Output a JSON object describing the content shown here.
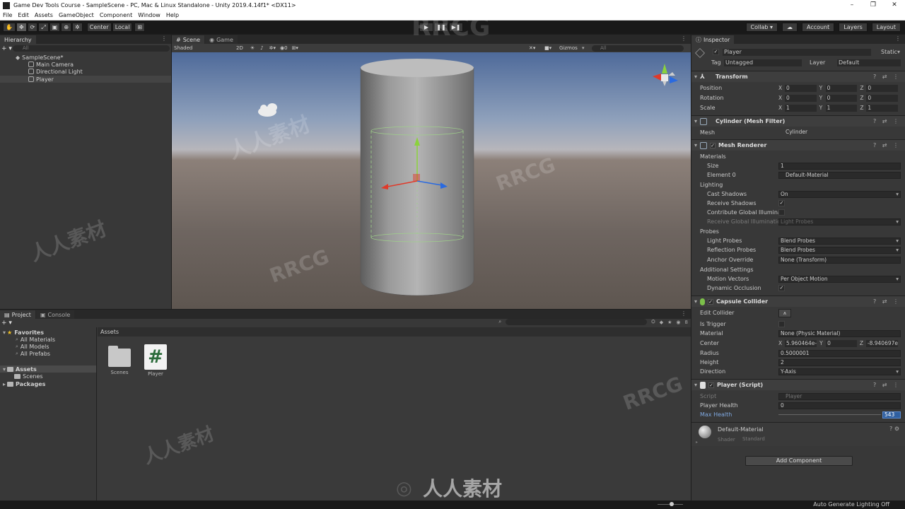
{
  "window": {
    "title": "Game Dev Tools Course - SampleScene - PC, Mac & Linux Standalone - Unity 2019.4.14f1* <DX11>",
    "controls": [
      "–",
      "❐",
      "✕"
    ]
  },
  "menu": [
    "File",
    "Edit",
    "Assets",
    "GameObject",
    "Component",
    "Window",
    "Help"
  ],
  "toolbar": {
    "tools": [
      "✋",
      "✥",
      "⟳",
      "⤢",
      "▣",
      "⊕",
      "✲"
    ],
    "center_label": "Center",
    "local_label": "Local",
    "snap_icon": "⊞",
    "play": "▶",
    "pause": "❚❚",
    "step": "▶❚",
    "collab_label": "Collab ▾",
    "cloud_icon": "☁",
    "account_label": "Account",
    "layers_label": "Layers",
    "layout_label": "Layout"
  },
  "hierarchy": {
    "tab": "Hierarchy",
    "plus": "+ ▾",
    "search_placeholder": "All",
    "menu": "⋮",
    "items": [
      "SampleScene*",
      "Main Camera",
      "Directional Light",
      "Player"
    ]
  },
  "scene": {
    "tabs": [
      "Scene",
      "Game"
    ],
    "menu": "⋮",
    "shading": "Shaded",
    "mode_2d": "2D",
    "effects_count": "0",
    "gizmos_label": "Gizmos",
    "search_placeholder": "All"
  },
  "project": {
    "tabs": [
      "Project",
      "Console"
    ],
    "plus": "+ ▾",
    "menu": "⋮",
    "tree": {
      "favorites_label": "Favorites",
      "favorites": [
        "All Materials",
        "All Models",
        "All Prefabs"
      ],
      "assets_label": "Assets",
      "assets_children": [
        "Scenes"
      ],
      "packages_label": "Packages"
    },
    "assets_header": "Assets",
    "hidden_count": "8",
    "items": [
      {
        "name": "Scenes",
        "icon": "folder-icon"
      },
      {
        "name": "Player",
        "icon": "csharp-script-icon",
        "glyph": "#"
      }
    ]
  },
  "inspector": {
    "tab": "Inspector",
    "menu": "⋮",
    "object_name": "Player",
    "static_label": "Static",
    "tag_label": "Tag",
    "tag_value": "Untagged",
    "layer_label": "Layer",
    "layer_value": "Default",
    "header_tools": "? ⇄ ⋮",
    "transform": {
      "title": "Transform",
      "position": {
        "label": "Position",
        "x": "0",
        "y": "0",
        "z": "0"
      },
      "rotation": {
        "label": "Rotation",
        "x": "0",
        "y": "0",
        "z": "0"
      },
      "scale": {
        "label": "Scale",
        "x": "1",
        "y": "1",
        "z": "1"
      }
    },
    "mesh_filter": {
      "title": "Cylinder (Mesh Filter)",
      "mesh_label": "Mesh",
      "mesh_value": "Cylinder"
    },
    "mesh_renderer": {
      "title": "Mesh Renderer",
      "materials_label": "Materials",
      "size_label": "Size",
      "size_value": "1",
      "element0_label": "Element 0",
      "element0_value": "Default-Material",
      "lighting_label": "Lighting",
      "cast_shadows_label": "Cast Shadows",
      "cast_shadows_value": "On",
      "receive_shadows_label": "Receive Shadows",
      "contribute_gi_label": "Contribute Global Illuminat",
      "receive_gi_label": "Receive Global Illuminatio",
      "receive_gi_value": "Light Probes",
      "probes_label": "Probes",
      "light_probes_label": "Light Probes",
      "light_probes_value": "Blend Probes",
      "reflection_probes_label": "Reflection Probes",
      "reflection_probes_value": "Blend Probes",
      "anchor_override_label": "Anchor Override",
      "anchor_override_value": "None (Transform)",
      "additional_label": "Additional Settings",
      "motion_vectors_label": "Motion Vectors",
      "motion_vectors_value": "Per Object Motion",
      "dynamic_occlusion_label": "Dynamic Occlusion"
    },
    "capsule_collider": {
      "title": "Capsule Collider",
      "edit_collider_label": "Edit Collider",
      "is_trigger_label": "Is Trigger",
      "material_label": "Material",
      "material_value": "None (Physic Material)",
      "center_label": "Center",
      "center_x": "5.960464e-",
      "center_y": "0",
      "center_z": "-8.940697e",
      "radius_label": "Radius",
      "radius_value": "0.5000001",
      "height_label": "Height",
      "height_value": "2",
      "direction_label": "Direction",
      "direction_value": "Y-Axis"
    },
    "player_script": {
      "title": "Player (Script)",
      "script_label": "Script",
      "script_value": "Player",
      "player_health_label": "Player Health",
      "player_health_value": "0",
      "max_health_label": "Max Health",
      "max_health_value": "543"
    },
    "material": {
      "name": "Default-Material",
      "shader_label": "Shader",
      "shader_value": "Standard"
    },
    "add_component_label": "Add Component"
  },
  "status": {
    "text": "Auto Generate Lighting Off"
  },
  "watermark": {
    "brand": "RRCG",
    "cn": "人人素材"
  },
  "colors": {
    "selection_blue": "#2f5fa0",
    "script_green": "#2b6b3a",
    "gizmo_y": "#8bd23c",
    "gizmo_x": "#e03a2a",
    "gizmo_z": "#2a6ae0"
  }
}
